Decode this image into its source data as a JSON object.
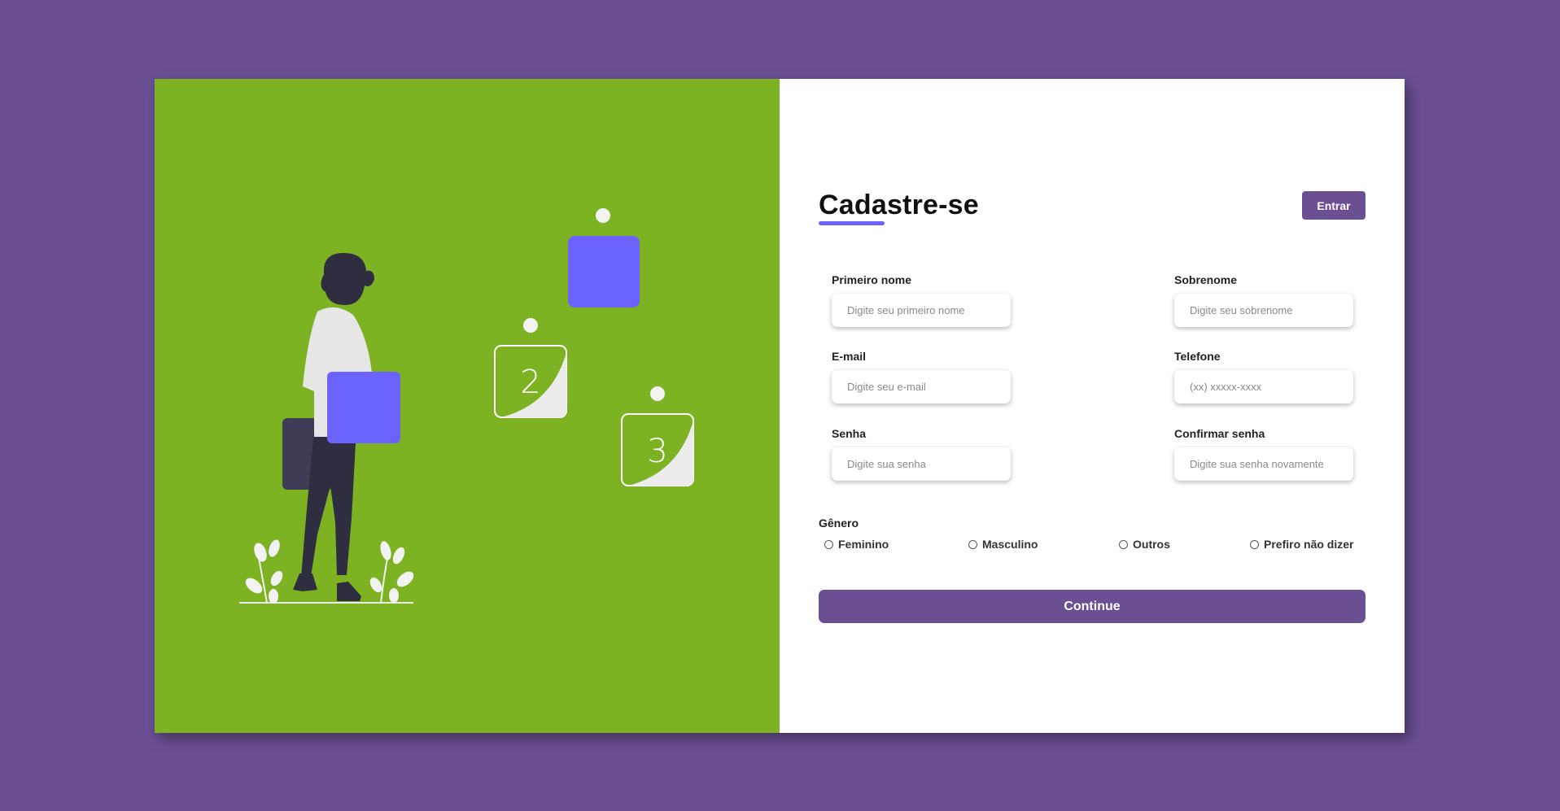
{
  "signup": {
    "title": "Cadastre-se",
    "login_button": "Entrar",
    "fields": [
      {
        "label": "Primeiro nome",
        "placeholder": "Digite seu primeiro nome"
      },
      {
        "label": "Sobrenome",
        "placeholder": "Digite seu sobrenome"
      },
      {
        "label": "E-mail",
        "placeholder": "Digite seu e-mail"
      },
      {
        "label": "Telefone",
        "placeholder": "(xx) xxxxx-xxxx"
      },
      {
        "label": "Senha",
        "placeholder": "Digite sua senha"
      },
      {
        "label": "Confirmar senha",
        "placeholder": "Digite sua senha novamente"
      }
    ],
    "gender": {
      "label": "Gênero",
      "options": [
        "Feminino",
        "Masculino",
        "Outros",
        "Prefiro não dizer"
      ]
    },
    "continue_button": "Continue"
  },
  "illustration": {
    "step_numbers": [
      "2",
      "3"
    ]
  },
  "colors": {
    "page_background": "#6a4f93",
    "illustration_background": "#7db223",
    "accent": "#6c63ff",
    "button": "#6a4f93"
  }
}
